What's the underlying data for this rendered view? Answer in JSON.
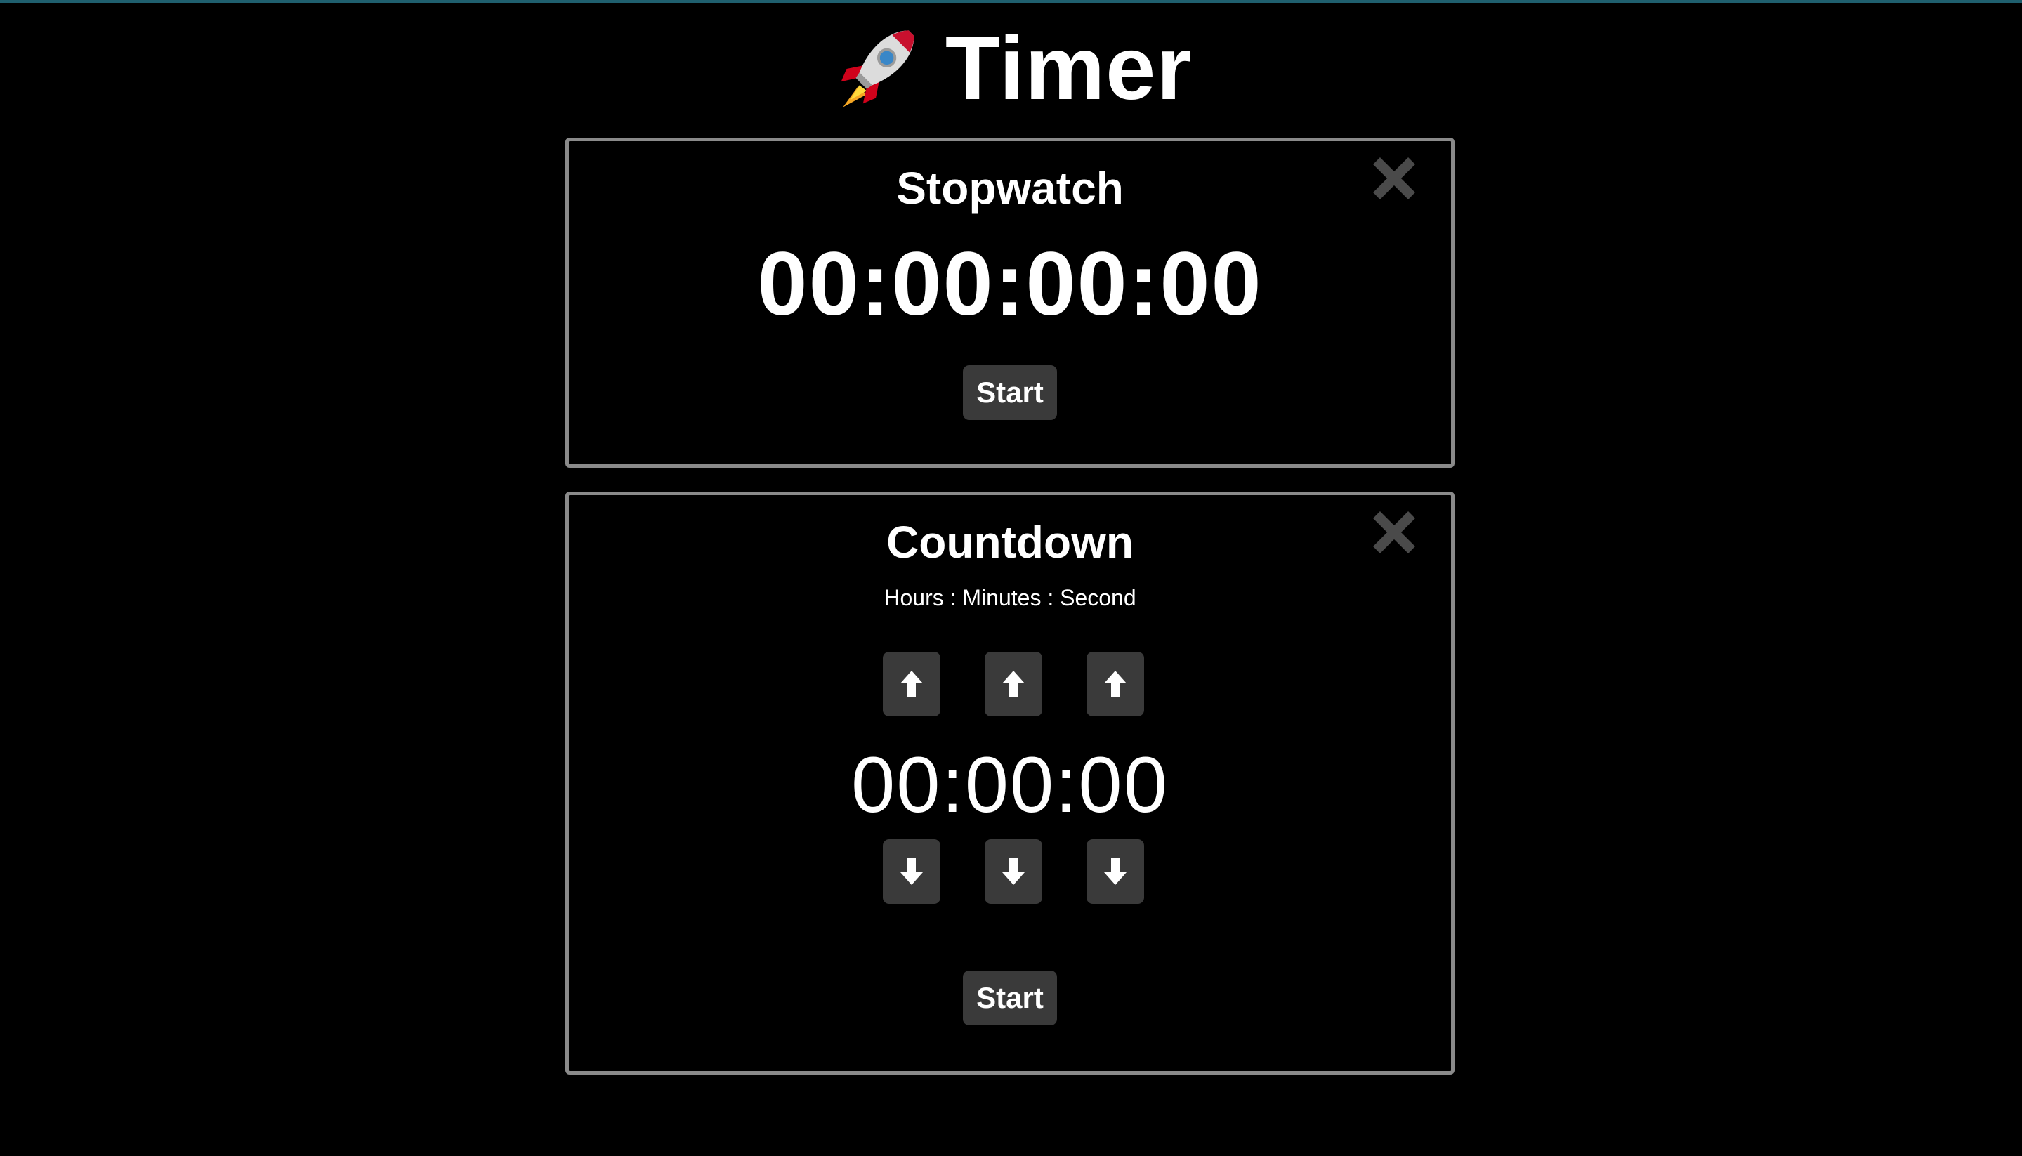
{
  "app": {
    "title": "Timer",
    "logo_icon": "rocket-icon"
  },
  "stopwatch": {
    "title": "Stopwatch",
    "display": "00:00:00:00",
    "start_label": "Start",
    "close_icon": "close-icon"
  },
  "countdown": {
    "title": "Countdown",
    "units_label": "Hours : Minutes : Second",
    "display": "00:00:00",
    "start_label": "Start",
    "close_icon": "close-icon",
    "up_icon": "arrow-up-icon",
    "down_icon": "arrow-down-icon"
  },
  "colors": {
    "background": "#000000",
    "panel_border": "#8a8a8a",
    "button_bg": "#3a3a3a",
    "close_icon": "#4a4a4a",
    "text": "#ffffff"
  }
}
